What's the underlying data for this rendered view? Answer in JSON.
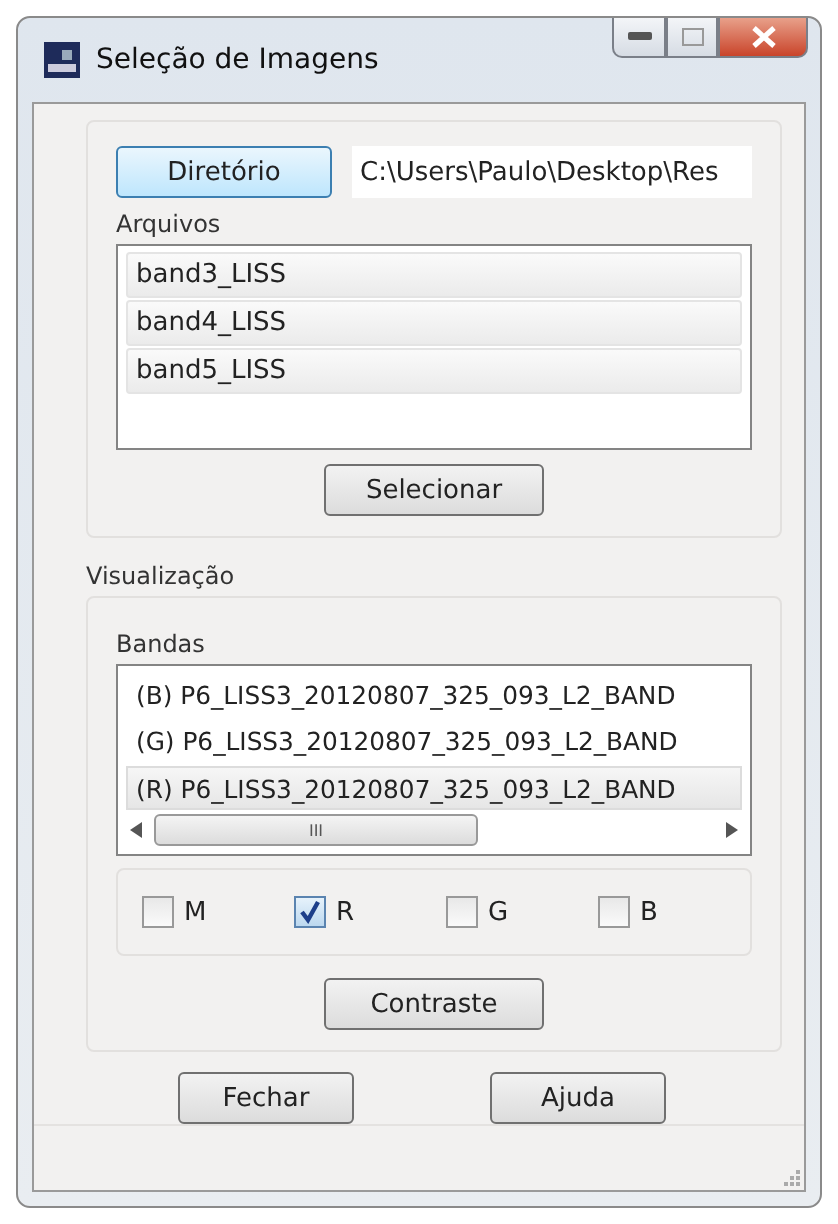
{
  "window": {
    "title": "Seleção de Imagens"
  },
  "directory": {
    "button": "Diretório",
    "path": "C:\\Users\\Paulo\\Desktop\\Res"
  },
  "files": {
    "label": "Arquivos",
    "items": [
      "band3_LISS",
      "band4_LISS",
      "band5_LISS"
    ],
    "button": "Selecionar"
  },
  "visualization": {
    "title": "Visualização",
    "bands_label": "Bandas",
    "bands": [
      {
        "label": "(B) P6_LISS3_20120807_325_093_L2_BAND",
        "selected": false
      },
      {
        "label": "(G) P6_LISS3_20120807_325_093_L2_BAND",
        "selected": false
      },
      {
        "label": "(R) P6_LISS3_20120807_325_093_L2_BAND",
        "selected": true
      }
    ],
    "scroll_grip": "III",
    "channels": [
      {
        "label": "M",
        "checked": false
      },
      {
        "label": "R",
        "checked": true
      },
      {
        "label": "G",
        "checked": false
      },
      {
        "label": "B",
        "checked": false
      }
    ],
    "button": "Contraste"
  },
  "buttons": [
    "Fechar",
    "Ajuda"
  ]
}
